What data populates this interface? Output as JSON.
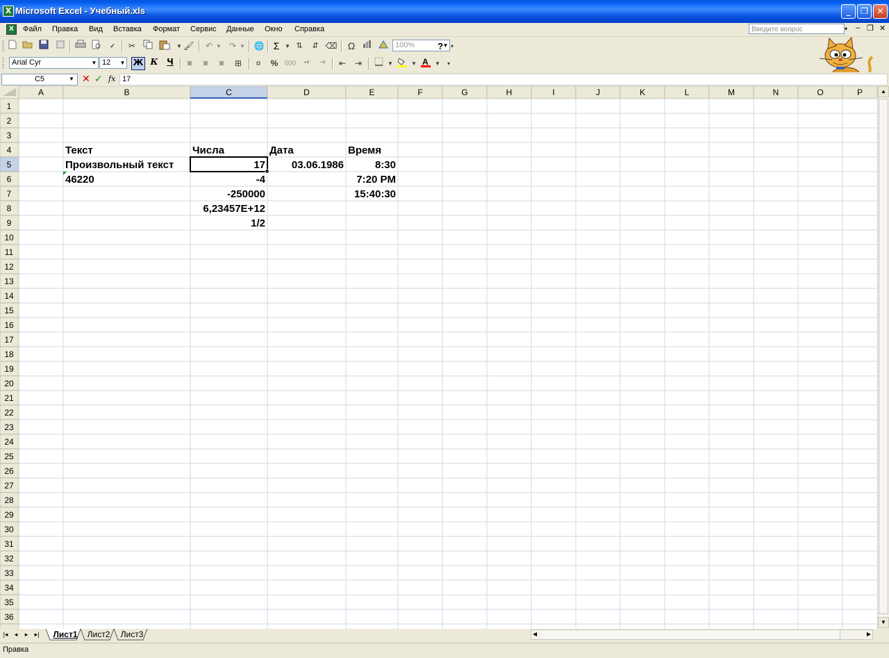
{
  "window": {
    "title": "Microsoft Excel - Учебный.xls",
    "buttons": [
      "_",
      "❐",
      "✕"
    ]
  },
  "menu": {
    "items": [
      "Файл",
      "Правка",
      "Вид",
      "Вставка",
      "Формат",
      "Сервис",
      "Данные",
      "Окно",
      "Справка"
    ],
    "help_placeholder": "Введите вопрос",
    "mdi_controls": [
      "▾",
      "‒",
      "❐",
      "✕"
    ]
  },
  "toolbar_standard": {
    "zoom": "100%",
    "icons": [
      "new-icon",
      "open-icon",
      "save-icon",
      "permission-icon",
      "print-icon",
      "print-preview-icon",
      "spelling-icon",
      "cut-icon",
      "copy-icon",
      "paste-icon",
      "format-painter-icon",
      "undo-icon",
      "redo-icon",
      "hyperlink-icon",
      "autosum-icon",
      "sort-ascending-icon",
      "sort-descending-icon",
      "clear-icon",
      "symbol-icon",
      "chart-wizard-icon",
      "drawing-icon",
      "help-icon"
    ],
    "glyphs": {
      "autosum": "Σ",
      "symbol": "Ω",
      "help": "?"
    }
  },
  "toolbar_formatting": {
    "font": "Arial Cyr",
    "size": "12",
    "bold": "Ж",
    "italic": "К",
    "underline": "Ч",
    "percent": "%",
    "thousands": "000",
    "fill_color": "#ffff00",
    "font_color": "#ff0000"
  },
  "formula_bar": {
    "name_box": "C5",
    "fx": "fx",
    "value": "17"
  },
  "grid": {
    "columns": [
      "A",
      "B",
      "C",
      "D",
      "E",
      "F",
      "G",
      "H",
      "I",
      "J",
      "K",
      "L",
      "M",
      "N",
      "O",
      "P"
    ],
    "row_count": 36,
    "active_cell": "C5",
    "cells": [
      {
        "ref": "B4",
        "value": "Текст",
        "align": "left"
      },
      {
        "ref": "C4",
        "value": "Числа",
        "align": "left"
      },
      {
        "ref": "D4",
        "value": "Дата",
        "align": "left"
      },
      {
        "ref": "E4",
        "value": "Время",
        "align": "left"
      },
      {
        "ref": "B5",
        "value": "Произвольный текст",
        "align": "left"
      },
      {
        "ref": "C5",
        "value": "17",
        "align": "right"
      },
      {
        "ref": "D5",
        "value": "03.06.1986",
        "align": "right"
      },
      {
        "ref": "E5",
        "value": "8:30",
        "align": "right"
      },
      {
        "ref": "B6",
        "value": "46220",
        "align": "left"
      },
      {
        "ref": "C6",
        "value": "-4",
        "align": "right"
      },
      {
        "ref": "E6",
        "value": "7:20 PM",
        "align": "right"
      },
      {
        "ref": "C7",
        "value": "-250000",
        "align": "right"
      },
      {
        "ref": "E7",
        "value": "15:40:30",
        "align": "right"
      },
      {
        "ref": "C8",
        "value": "6,23457E+12",
        "align": "right"
      },
      {
        "ref": "C9",
        "value": "1/2",
        "align": "right"
      }
    ]
  },
  "sheet_tabs": {
    "nav": [
      "|◂",
      "◂",
      "▸",
      "▸|"
    ],
    "tabs": [
      "Лист1",
      "Лист2",
      "Лист3"
    ],
    "active": "Лист1"
  },
  "status": {
    "text": "Правка"
  },
  "colors": {
    "titlebar": "#0a5ad8",
    "header_bg": "#ece9d8",
    "header_selected": "#c5d2e8",
    "grid_line": "#d0d7e5"
  }
}
